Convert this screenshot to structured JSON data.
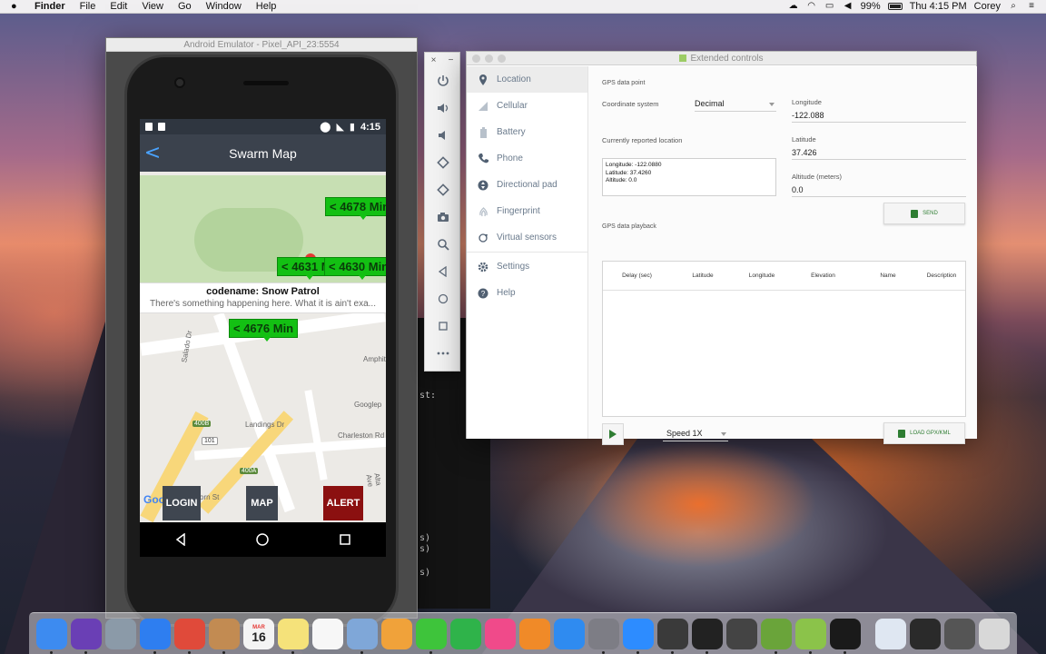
{
  "menubar": {
    "apple": "",
    "items": [
      "Finder",
      "File",
      "Edit",
      "View",
      "Go",
      "Window",
      "Help"
    ],
    "battery_percent": "99%",
    "clock": "Thu 4:15 PM",
    "user": "Corey"
  },
  "terminal": {
    "lines": [
      "st:",
      "s)",
      "s)",
      "s)"
    ]
  },
  "emulator": {
    "window_title": "Android Emulator - Pixel_API_23:5554",
    "status_time": "4:15",
    "app_title": "Swarm Map",
    "back_glyph": "<",
    "markers": [
      "< 4678 Min",
      "< 4631 M",
      "< 4630 Min",
      "< 4676 Min"
    ],
    "info_title": "codename: Snow Patrol",
    "info_body": "There's something happening here. What it is ain't exa...",
    "map_labels": [
      "Salado Dr",
      "Amphithe",
      "Googlep",
      "Landings Dr",
      "Charleston Rd",
      "Alta Ave",
      "orn St"
    ],
    "shields": [
      "400B",
      "101",
      "400A"
    ],
    "google": "Google",
    "buttons": {
      "login": "LOGIN",
      "map": "MAP",
      "alert": "ALERT"
    }
  },
  "toolbar": {
    "close": "×",
    "minimize": "−",
    "buttons": [
      "power-icon",
      "volume-up-icon",
      "volume-down-icon",
      "rotate-left-icon",
      "rotate-right-icon",
      "camera-icon",
      "zoom-icon",
      "back-icon",
      "home-icon",
      "overview-icon",
      "more-icon"
    ]
  },
  "extended": {
    "window_title": "Extended controls",
    "sidebar": [
      {
        "label": "Location",
        "icon": "location-pin-icon"
      },
      {
        "label": "Cellular",
        "icon": "signal-icon"
      },
      {
        "label": "Battery",
        "icon": "battery-icon"
      },
      {
        "label": "Phone",
        "icon": "phone-icon"
      },
      {
        "label": "Directional pad",
        "icon": "dpad-icon"
      },
      {
        "label": "Fingerprint",
        "icon": "fingerprint-icon"
      },
      {
        "label": "Virtual sensors",
        "icon": "sensors-icon"
      },
      {
        "label": "Settings",
        "icon": "gear-icon"
      },
      {
        "label": "Help",
        "icon": "help-icon"
      }
    ],
    "gps_point_label": "GPS data point",
    "coord_system_label": "Coordinate system",
    "coord_system_value": "Decimal",
    "longitude_label": "Longitude",
    "longitude_value": "-122.088",
    "latitude_label": "Latitude",
    "latitude_value": "37.426",
    "altitude_label": "Altitude (meters)",
    "altitude_value": "0.0",
    "reported_label": "Currently reported location",
    "reported_lines": [
      "Longitude: -122.0880",
      "Latitude: 37.4260",
      "Altitude: 0.0"
    ],
    "send_label": "SEND",
    "playback_label": "GPS data playback",
    "table_headers": [
      "Delay (sec)",
      "Latitude",
      "Longitude",
      "Elevation",
      "Name",
      "Description"
    ],
    "speed_value": "Speed 1X",
    "load_label": "LOAD GPX/KML"
  },
  "dock": {
    "apps": [
      {
        "name": "finder-icon",
        "color": "#3d8bf0"
      },
      {
        "name": "siri-icon",
        "color": "#6a3fb5"
      },
      {
        "name": "launchpad-icon",
        "color": "#8b9aa8"
      },
      {
        "name": "safari-icon",
        "color": "#2e7ef0"
      },
      {
        "name": "chrome-icon",
        "color": "#e04a3a"
      },
      {
        "name": "contacts-icon",
        "color": "#c28b52"
      },
      {
        "name": "calendar-icon",
        "color": "#f4f4f4"
      },
      {
        "name": "notes-icon",
        "color": "#f5e27a"
      },
      {
        "name": "reminders-icon",
        "color": "#f7f7f7"
      },
      {
        "name": "preview-icon",
        "color": "#7fa7d8"
      },
      {
        "name": "photos-icon",
        "color": "#f0a23a"
      },
      {
        "name": "messages-icon",
        "color": "#3ec43b"
      },
      {
        "name": "facetime-icon",
        "color": "#2fb34a"
      },
      {
        "name": "itunes-icon",
        "color": "#f04a8a"
      },
      {
        "name": "ibooks-icon",
        "color": "#f08a28"
      },
      {
        "name": "appstore-icon",
        "color": "#2f8bf0"
      },
      {
        "name": "system-prefs-icon",
        "color": "#7d7d85"
      },
      {
        "name": "zoom-icon",
        "color": "#2d8cff"
      },
      {
        "name": "sublime-icon",
        "color": "#3a3a3a"
      },
      {
        "name": "terminal-icon",
        "color": "#222222"
      },
      {
        "name": "sublime-text-icon",
        "color": "#444444"
      },
      {
        "name": "android-studio-icon",
        "color": "#6aa43a"
      },
      {
        "name": "android-emulator-icon",
        "color": "#8bc34a"
      },
      {
        "name": "terminal-window-icon",
        "color": "#1a1a1a"
      }
    ],
    "calendar_month": "MAR",
    "calendar_day": "16",
    "documents": [
      {
        "name": "downloads-stack-icon",
        "color": "#dfe7f2"
      },
      {
        "name": "desktop-thumb-icon",
        "color": "#2a2a2a"
      },
      {
        "name": "window-thumb-icon",
        "color": "#555555"
      },
      {
        "name": "trash-icon",
        "color": "#d8d8d8"
      }
    ]
  }
}
